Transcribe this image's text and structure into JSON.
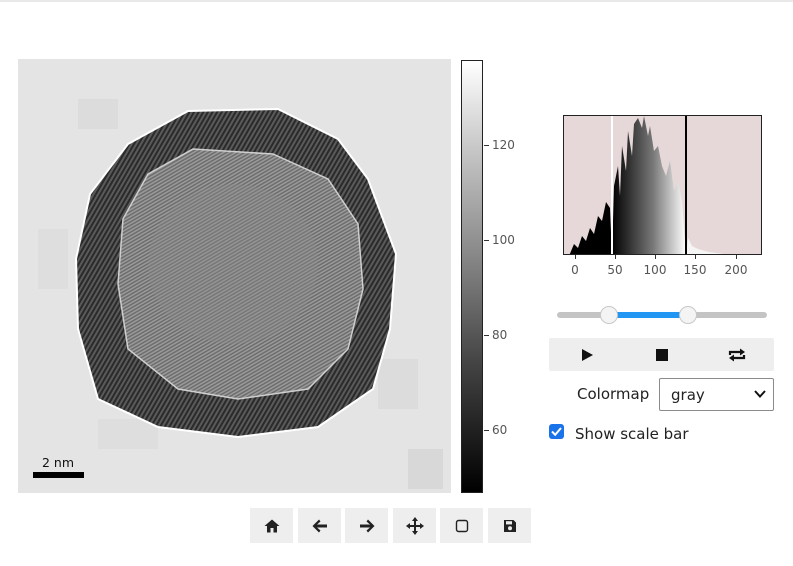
{
  "colorbar": {
    "ticks": [
      "120",
      "100",
      "80",
      "60"
    ]
  },
  "image": {
    "scalebar_label": "2 nm"
  },
  "histogram": {
    "ticks": [
      "0",
      "50",
      "100",
      "150",
      "200"
    ]
  },
  "range_slider": {
    "low_fraction": 0.23,
    "high_fraction": 0.61
  },
  "player": {
    "buttons": [
      "play-icon",
      "stop-icon",
      "repeat-icon"
    ]
  },
  "colormap": {
    "label": "Colormap",
    "selected": "gray"
  },
  "scale_bar_toggle": {
    "label": "Show scale bar",
    "checked": true
  },
  "toolbar": {
    "buttons": [
      "home-icon",
      "back-arrow-icon",
      "forward-arrow-icon",
      "pan-icon",
      "zoom-rect-icon",
      "save-icon"
    ]
  },
  "colors": {
    "accent": "#2196f3",
    "checkbox": "#1a73e8",
    "histogram_bg": "#e6d8d8"
  }
}
